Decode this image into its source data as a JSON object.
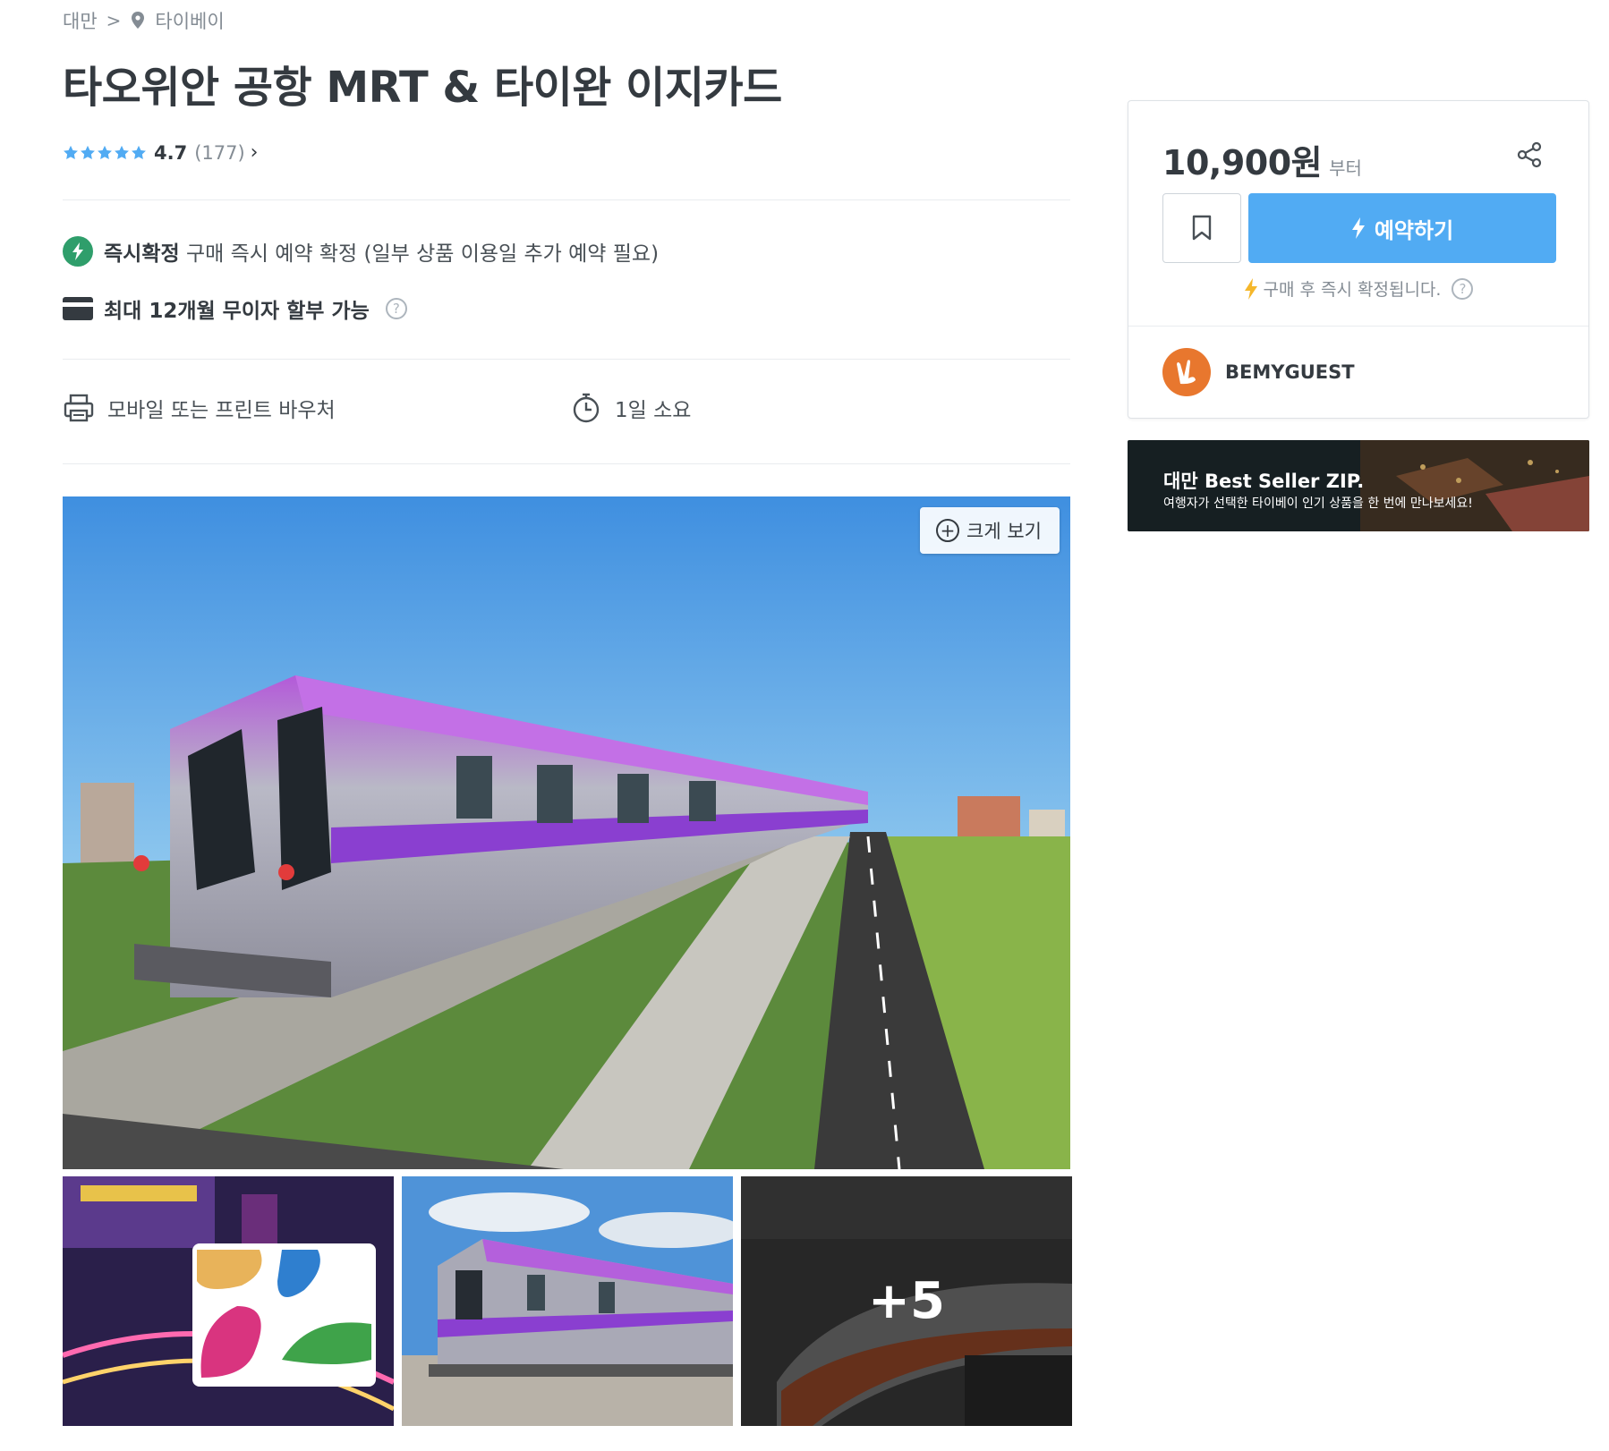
{
  "breadcrumb": {
    "country": "대만",
    "city": "타이베이"
  },
  "product": {
    "title": "타오위안 공항 MRT & 타이완 이지카드",
    "rating": "4.7",
    "review_count": "(177)"
  },
  "features": {
    "instant_label": "즉시확정",
    "instant_desc": "구매 즉시 예약 확정 (일부 상품 이용일 추가 예약 필요)",
    "installment": "최대 12개월 무이자 할부 가능",
    "help_glyph": "?"
  },
  "info": {
    "voucher": "모바일 또는 프린트 바우처",
    "duration": "1일 소요"
  },
  "gallery": {
    "zoom_label": "크게 보기",
    "more_count": "+5"
  },
  "booking": {
    "price": "10,900원",
    "price_suffix": "부터",
    "reserve_label": "예약하기",
    "confirm_note": "구매 후 즉시 확정됩니다.",
    "seller_name": "BEMYGUEST"
  },
  "banner": {
    "title": "대만 Best Seller ZIP.",
    "subtitle": "여행자가 선택한 타이베이 인기 상품을 한 번에 만나보세요!"
  },
  "colors": {
    "primary": "#51abf3",
    "instant_green": "#2f9e6b",
    "star_blue": "#51abf3",
    "train_purple": "#a24bd6"
  },
  "icons": [
    "map-pin-icon",
    "star-icon",
    "lightning-icon",
    "credit-card-icon",
    "help-icon",
    "printer-icon",
    "stopwatch-icon",
    "zoom-plus-icon",
    "share-icon",
    "bookmark-icon",
    "seller-logo-icon"
  ]
}
